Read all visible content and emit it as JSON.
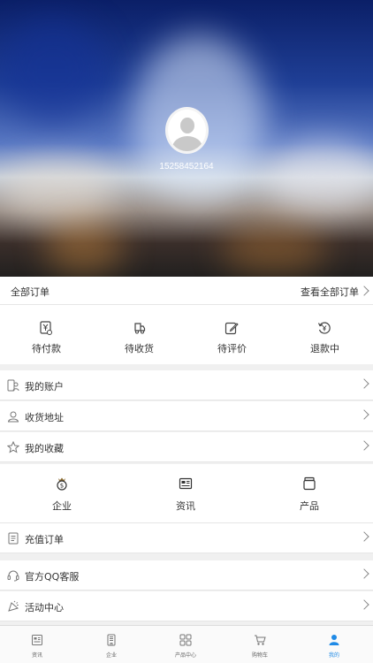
{
  "profile": {
    "phone": "15258452164"
  },
  "orders": {
    "title": "全部订单",
    "view_all": "查看全部订单",
    "items": [
      {
        "label": "待付款",
        "icon": "payment-icon"
      },
      {
        "label": "待收货",
        "icon": "truck-icon"
      },
      {
        "label": "待评价",
        "icon": "edit-icon"
      },
      {
        "label": "退款中",
        "icon": "refund-icon"
      }
    ]
  },
  "menu": {
    "account": "我的账户",
    "address": "收货地址",
    "favorites": "我的收藏",
    "recharge": "充值订单",
    "service": "官方QQ客服",
    "activity": "活动中心"
  },
  "categories": [
    {
      "label": "企业",
      "icon": "enterprise-icon"
    },
    {
      "label": "资讯",
      "icon": "news-icon"
    },
    {
      "label": "产品",
      "icon": "product-icon"
    }
  ],
  "tabbar": {
    "active": "我的",
    "tabs": [
      {
        "label": "资讯",
        "icon": "news-tab-icon"
      },
      {
        "label": "企业",
        "icon": "enterprise-tab-icon"
      },
      {
        "label": "产品中心",
        "icon": "grid-icon"
      },
      {
        "label": "购物车",
        "icon": "cart-icon"
      },
      {
        "label": "我的",
        "icon": "user-icon"
      }
    ]
  },
  "colors": {
    "accent": "#1f8ae6",
    "divider": "#e6e6e6",
    "background": "#f0f0f0"
  }
}
